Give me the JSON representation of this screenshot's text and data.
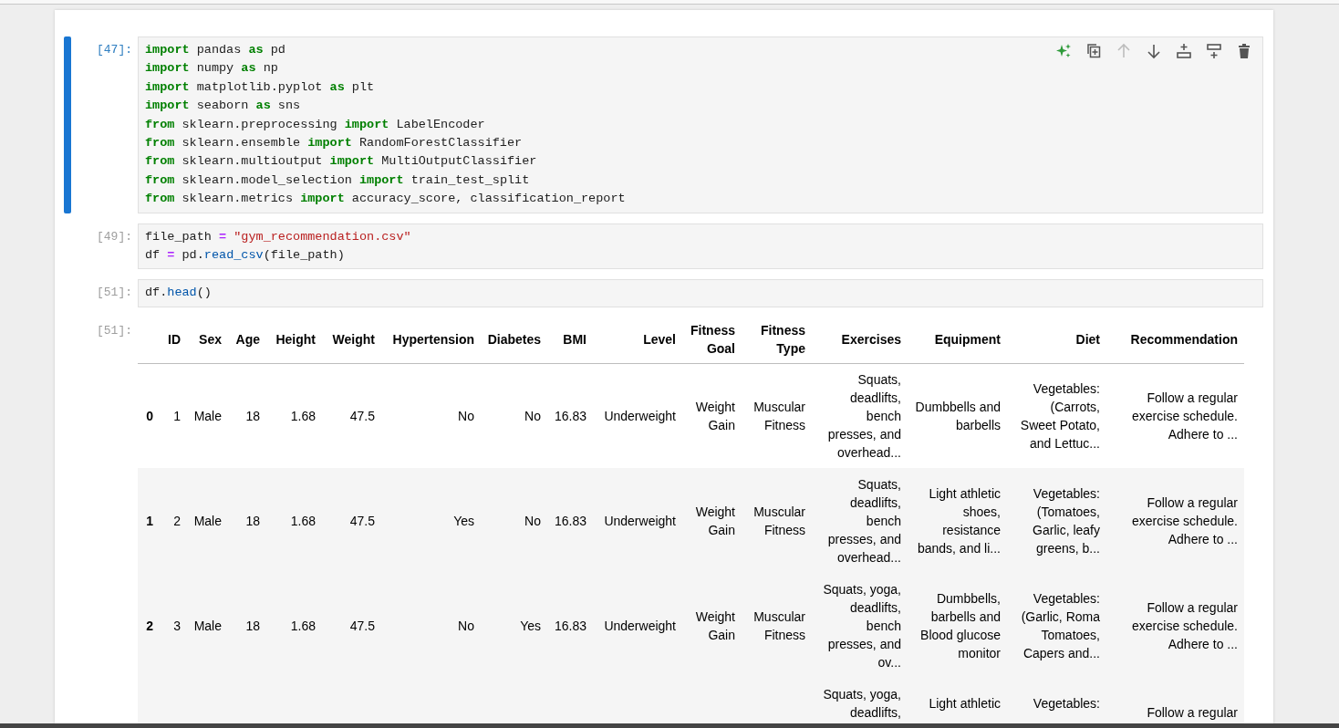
{
  "cells": [
    {
      "prompt": "[47]:",
      "selected": true,
      "toolbar": [
        {
          "kind": "ai",
          "disabled": false
        },
        {
          "kind": "duplicate",
          "disabled": false
        },
        {
          "kind": "up",
          "disabled": true
        },
        {
          "kind": "down",
          "disabled": false
        },
        {
          "kind": "insert-above",
          "disabled": false
        },
        {
          "kind": "insert-below",
          "disabled": false
        },
        {
          "kind": "delete",
          "disabled": false
        }
      ],
      "lines": [
        [
          {
            "kind": "kw",
            "t": "import"
          },
          {
            "kind": "p",
            "t": " pandas "
          },
          {
            "kind": "kw",
            "t": "as"
          },
          {
            "kind": "p",
            "t": " pd"
          }
        ],
        [
          {
            "kind": "kw",
            "t": "import"
          },
          {
            "kind": "p",
            "t": " numpy "
          },
          {
            "kind": "kw",
            "t": "as"
          },
          {
            "kind": "p",
            "t": " np"
          }
        ],
        [
          {
            "kind": "kw",
            "t": "import"
          },
          {
            "kind": "p",
            "t": " matplotlib.pyplot "
          },
          {
            "kind": "kw",
            "t": "as"
          },
          {
            "kind": "p",
            "t": " plt"
          }
        ],
        [
          {
            "kind": "kw",
            "t": "import"
          },
          {
            "kind": "p",
            "t": " seaborn "
          },
          {
            "kind": "kw",
            "t": "as"
          },
          {
            "kind": "p",
            "t": " sns"
          }
        ],
        [
          {
            "kind": "kw",
            "t": "from"
          },
          {
            "kind": "p",
            "t": " sklearn.preprocessing "
          },
          {
            "kind": "kw",
            "t": "import"
          },
          {
            "kind": "p",
            "t": " LabelEncoder"
          }
        ],
        [
          {
            "kind": "kw",
            "t": "from"
          },
          {
            "kind": "p",
            "t": " sklearn.ensemble "
          },
          {
            "kind": "kw",
            "t": "import"
          },
          {
            "kind": "p",
            "t": " RandomForestClassifier"
          }
        ],
        [
          {
            "kind": "kw",
            "t": "from"
          },
          {
            "kind": "p",
            "t": " sklearn.multioutput "
          },
          {
            "kind": "kw",
            "t": "import"
          },
          {
            "kind": "p",
            "t": " MultiOutputClassifier"
          }
        ],
        [
          {
            "kind": "kw",
            "t": "from"
          },
          {
            "kind": "p",
            "t": " sklearn.model_selection "
          },
          {
            "kind": "kw",
            "t": "import"
          },
          {
            "kind": "p",
            "t": " train_test_split"
          }
        ],
        [
          {
            "kind": "kw",
            "t": "from"
          },
          {
            "kind": "p",
            "t": " sklearn.metrics "
          },
          {
            "kind": "kw",
            "t": "import"
          },
          {
            "kind": "p",
            "t": " accuracy_score, classification_report"
          }
        ]
      ]
    },
    {
      "prompt": "[49]:",
      "selected": false,
      "lines": [
        [
          {
            "kind": "p",
            "t": "file_path "
          },
          {
            "kind": "op",
            "t": "="
          },
          {
            "kind": "str",
            "t": " \"gym_recommendation.csv\""
          }
        ],
        [
          {
            "kind": "p",
            "t": "df "
          },
          {
            "kind": "op",
            "t": "="
          },
          {
            "kind": "p",
            "t": " pd."
          },
          {
            "kind": "fn",
            "t": "read_csv"
          },
          {
            "kind": "p",
            "t": "(file_path)"
          }
        ]
      ]
    },
    {
      "prompt": "[51]:",
      "selected": false,
      "lines": [
        [
          {
            "kind": "p",
            "t": "df."
          },
          {
            "kind": "fn",
            "t": "head"
          },
          {
            "kind": "p",
            "t": "()"
          }
        ]
      ]
    }
  ],
  "output": {
    "prompt": "[51]:",
    "columns": [
      "ID",
      "Sex",
      "Age",
      "Height",
      "Weight",
      "Hypertension",
      "Diabetes",
      "BMI",
      "Level",
      "Fitness Goal",
      "Fitness Type",
      "Exercises",
      "Equipment",
      "Diet",
      "Recommendation"
    ],
    "rows": [
      {
        "index": "0",
        "cells": [
          "1",
          "Male",
          "18",
          "1.68",
          "47.5",
          "No",
          "No",
          "16.83",
          "Underweight",
          "Weight Gain",
          "Muscular Fitness",
          "Squats, deadlifts, bench presses, and overhead...",
          "Dumbbells and barbells",
          "Vegetables: (Carrots, Sweet Potato, and Lettuc...",
          "Follow a regular exercise schedule. Adhere to ..."
        ]
      },
      {
        "index": "1",
        "cells": [
          "2",
          "Male",
          "18",
          "1.68",
          "47.5",
          "Yes",
          "No",
          "16.83",
          "Underweight",
          "Weight Gain",
          "Muscular Fitness",
          "Squats, deadlifts, bench presses, and overhead...",
          "Light athletic shoes, resistance bands, and li...",
          "Vegetables: (Tomatoes, Garlic, leafy greens, b...",
          "Follow a regular exercise schedule. Adhere to ..."
        ]
      },
      {
        "index": "2",
        "cells": [
          "3",
          "Male",
          "18",
          "1.68",
          "47.5",
          "No",
          "Yes",
          "16.83",
          "Underweight",
          "Weight Gain",
          "Muscular Fitness",
          "Squats, yoga, deadlifts, bench presses, and ov...",
          "Dumbbells, barbells and Blood glucose monitor",
          "Vegetables: (Garlic, Roma Tomatoes, Capers and...",
          "Follow a regular exercise schedule. Adhere to ..."
        ]
      }
    ],
    "partial_row": {
      "exercises": "Squats, yoga, deadlifts,",
      "equipment": "Light athletic",
      "diet": "Vegetables:",
      "recommendation": "Follow a regular"
    }
  }
}
